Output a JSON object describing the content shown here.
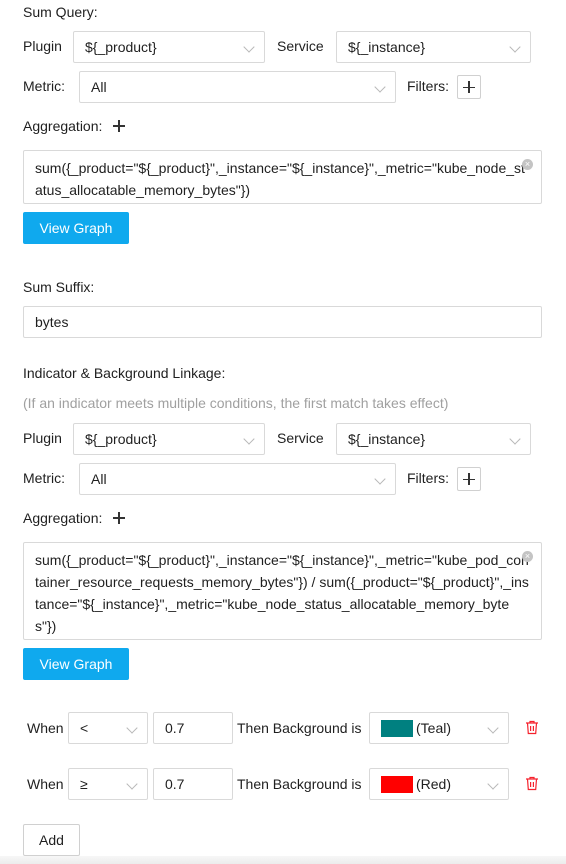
{
  "sum_query": {
    "title": "Sum Query:",
    "plugin_label": "Plugin",
    "plugin_value": "${_product}",
    "service_label": "Service",
    "service_value": "${_instance}",
    "metric_label": "Metric:",
    "metric_value": "All",
    "filters_label": "Filters:",
    "aggregation_label": "Aggregation:",
    "expression": "sum({_product=\"${_product}\",_instance=\"${_instance}\",_metric=\"kube_node_status_allocatable_memory_bytes\"})",
    "view_graph_label": "View Graph"
  },
  "sum_suffix": {
    "label": "Sum Suffix:",
    "value": "bytes"
  },
  "indicator": {
    "title": "Indicator & Background Linkage:",
    "hint": "(If an indicator meets multiple conditions, the first match takes effect)",
    "plugin_label": "Plugin",
    "plugin_value": "${_product}",
    "service_label": "Service",
    "service_value": "${_instance}",
    "metric_label": "Metric:",
    "metric_value": "All",
    "filters_label": "Filters:",
    "aggregation_label": "Aggregation:",
    "expression": "sum({_product=\"${_product}\",_instance=\"${_instance}\",_metric=\"kube_pod_container_resource_requests_memory_bytes\"}) / sum({_product=\"${_product}\",_instance=\"${_instance}\",_metric=\"kube_node_status_allocatable_memory_bytes\"})",
    "view_graph_label": "View Graph"
  },
  "rules": [
    {
      "when_label": "When",
      "operator": "<",
      "threshold": "0.7",
      "then_label": "Then Background is",
      "color_name": "(Teal)",
      "color": "#008080"
    },
    {
      "when_label": "When",
      "operator": "≥",
      "threshold": "0.7",
      "then_label": "Then Background is",
      "color_name": "(Red)",
      "color": "#ff0000"
    }
  ],
  "add_label": "Add",
  "colors": {
    "primary": "#0fa9ee",
    "danger": "#f5222d"
  }
}
